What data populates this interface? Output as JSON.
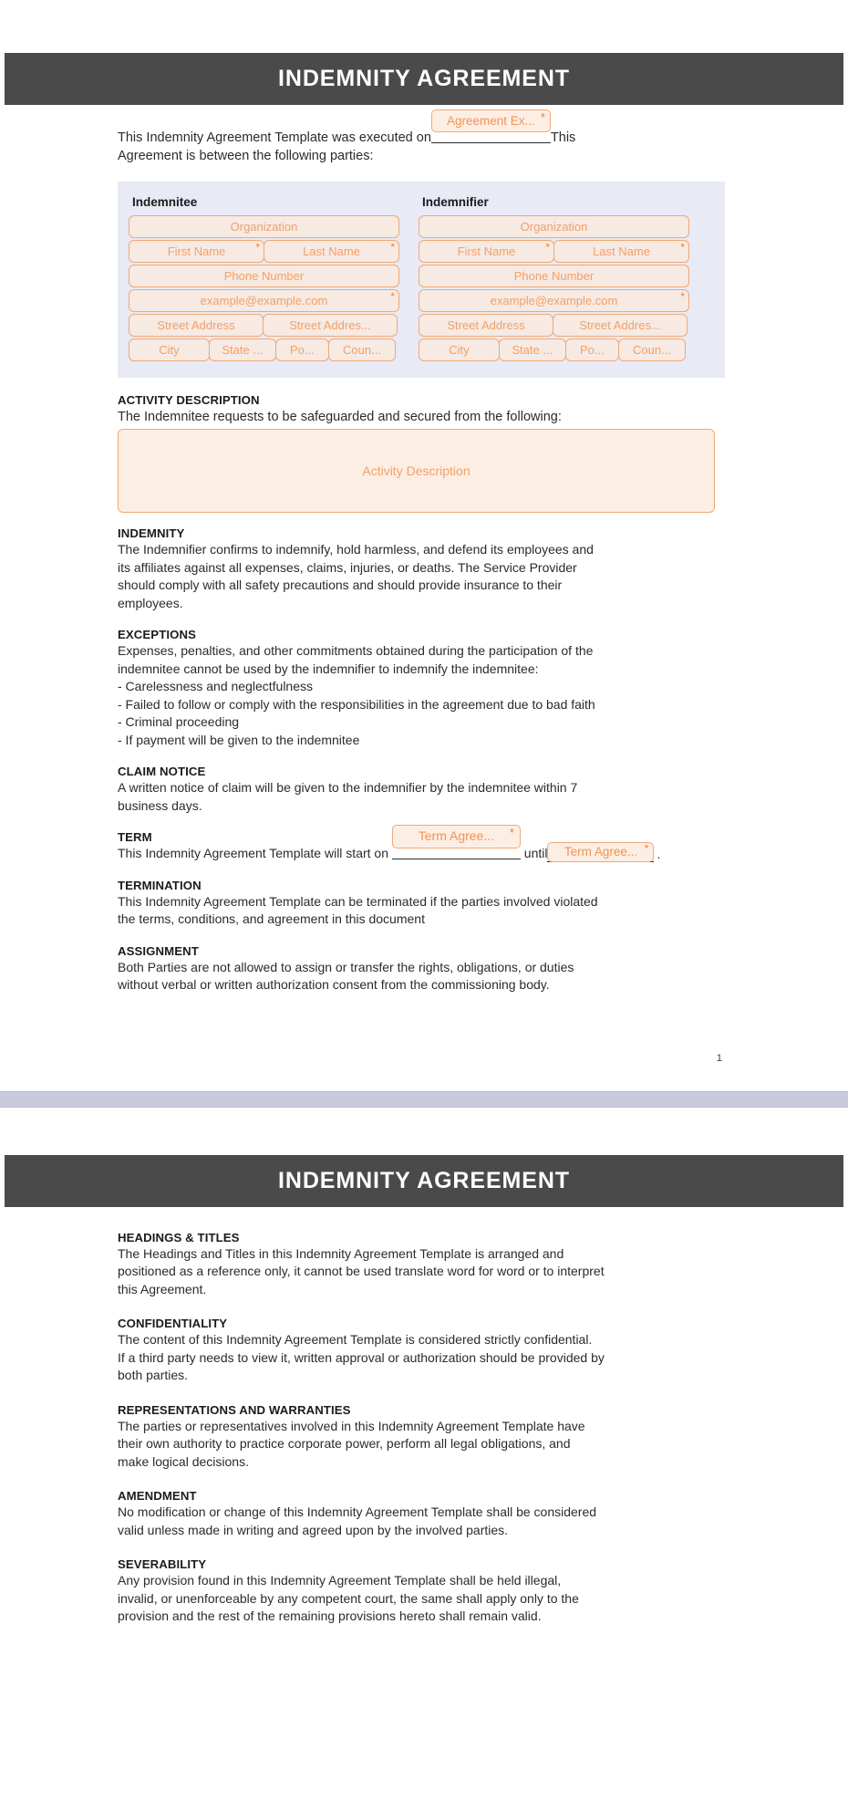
{
  "document": {
    "banner_title": "INDEMNITY AGREEMENT",
    "page_number": "1",
    "required_marker": "*",
    "colors": {
      "banner_bg": "#4a4a4a",
      "parties_bg": "#e8eaf6",
      "field_border": "#f0a875",
      "field_bg": "#f6eae3",
      "field_text": "#f2a06a",
      "required_star": "#ef7d2e",
      "body_text": "#2b2b2b"
    }
  },
  "intro": {
    "line1_before": "This Indemnity Agreement Template was executed on",
    "date_field_placeholder": "Agreement Ex...",
    "line1_after": "This",
    "line2": "Agreement is between the following parties:"
  },
  "parties": {
    "indemnitee": {
      "title": "Indemnitee",
      "organization": "Organization",
      "first_name": "First Name",
      "last_name": "Last Name",
      "phone": "Phone Number",
      "email": "example@example.com",
      "street_address": "Street Address",
      "street_address_2": "Street Addres...",
      "city": "City",
      "state": "State ...",
      "postal": "Po...",
      "country": "Coun..."
    },
    "indemnifier": {
      "title": "Indemnifier",
      "organization": "Organization",
      "first_name": "First Name",
      "last_name": "Last Name",
      "phone": "Phone Number",
      "email": "example@example.com",
      "street_address": "Street Address",
      "street_address_2": "Street Addres...",
      "city": "City",
      "state": "State ...",
      "postal": "Po...",
      "country": "Coun..."
    }
  },
  "activity": {
    "heading": "ACTIVITY DESCRIPTION",
    "lead": "The Indemnitee requests to be safeguarded and secured from the following:",
    "textarea_placeholder": "Activity Description"
  },
  "sections": {
    "indemnity": {
      "heading": "INDEMNITY",
      "line1": "The Indemnifier confirms to indemnify, hold harmless, and defend its employees and",
      "line2": "its affiliates against all expenses, claims, injuries, or deaths. The Service Provider",
      "line3": "should comply with all safety precautions and should provide insurance to their",
      "line4": "employees."
    },
    "exceptions": {
      "heading": "EXCEPTIONS",
      "line1": "Expenses, penalties, and other commitments obtained during the participation of the",
      "line2": "indemnitee cannot be used by the indemnifier to indemnify the indemnitee:",
      "bullet1": "- Carelessness and neglectfulness",
      "bullet2": "- Failed to follow or comply with the responsibilities in the agreement due to bad faith",
      "bullet3": "- Criminal proceeding",
      "bullet4": "- If payment will be given to the indemnitee"
    },
    "claim_notice": {
      "heading": "CLAIM NOTICE",
      "line1": "A written notice of claim will be given to the indemnifier by the indemnitee within 7",
      "line2": "business days."
    },
    "term": {
      "heading": "TERM",
      "before": "This Indemnity Agreement Template will start on",
      "start_field_placeholder": "Term Agree...",
      "middle": "until",
      "end_field_placeholder": "Term Agree...",
      "after": "."
    },
    "termination": {
      "heading": "TERMINATION",
      "line1": "This Indemnity Agreement Template can be terminated if the parties involved violated",
      "line2": "the terms, conditions, and agreement in this document"
    },
    "assignment": {
      "heading": "ASSIGNMENT",
      "line1": "Both Parties are not allowed to assign or transfer the rights, obligations, or duties",
      "line2": "without verbal or written authorization consent from the commissioning body."
    }
  },
  "page2": {
    "banner_title": "INDEMNITY AGREEMENT",
    "headings_titles": {
      "heading": "HEADINGS & TITLES",
      "line1": "The Headings and Titles in this Indemnity Agreement Template is arranged and",
      "line2": "positioned as a reference only, it cannot be used translate word for word or to interpret",
      "line3": "this Agreement."
    },
    "confidentiality": {
      "heading": "CONFIDENTIALITY",
      "line1": "The content of this Indemnity Agreement Template is considered strictly confidential.",
      "line2": "If a third party needs to view it, written approval or authorization should be provided by",
      "line3": "both parties."
    },
    "representations": {
      "heading": "REPRESENTATIONS AND WARRANTIES",
      "line1": "The parties or representatives involved in this Indemnity Agreement Template have",
      "line2": "their own authority to practice corporate power, perform all legal obligations, and",
      "line3": "make logical decisions."
    },
    "amendment": {
      "heading": "AMENDMENT",
      "line1": "No modification or change of this Indemnity Agreement Template shall be considered",
      "line2": "valid unless made in writing and agreed upon by the involved parties."
    },
    "severability": {
      "heading": "SEVERABILITY",
      "line1": "Any provision found in this Indemnity Agreement Template shall be held illegal,",
      "line2": "invalid, or unenforceable by any competent court, the same shall apply only to the",
      "line3": "provision and the rest of the remaining provisions hereto shall remain valid."
    }
  }
}
